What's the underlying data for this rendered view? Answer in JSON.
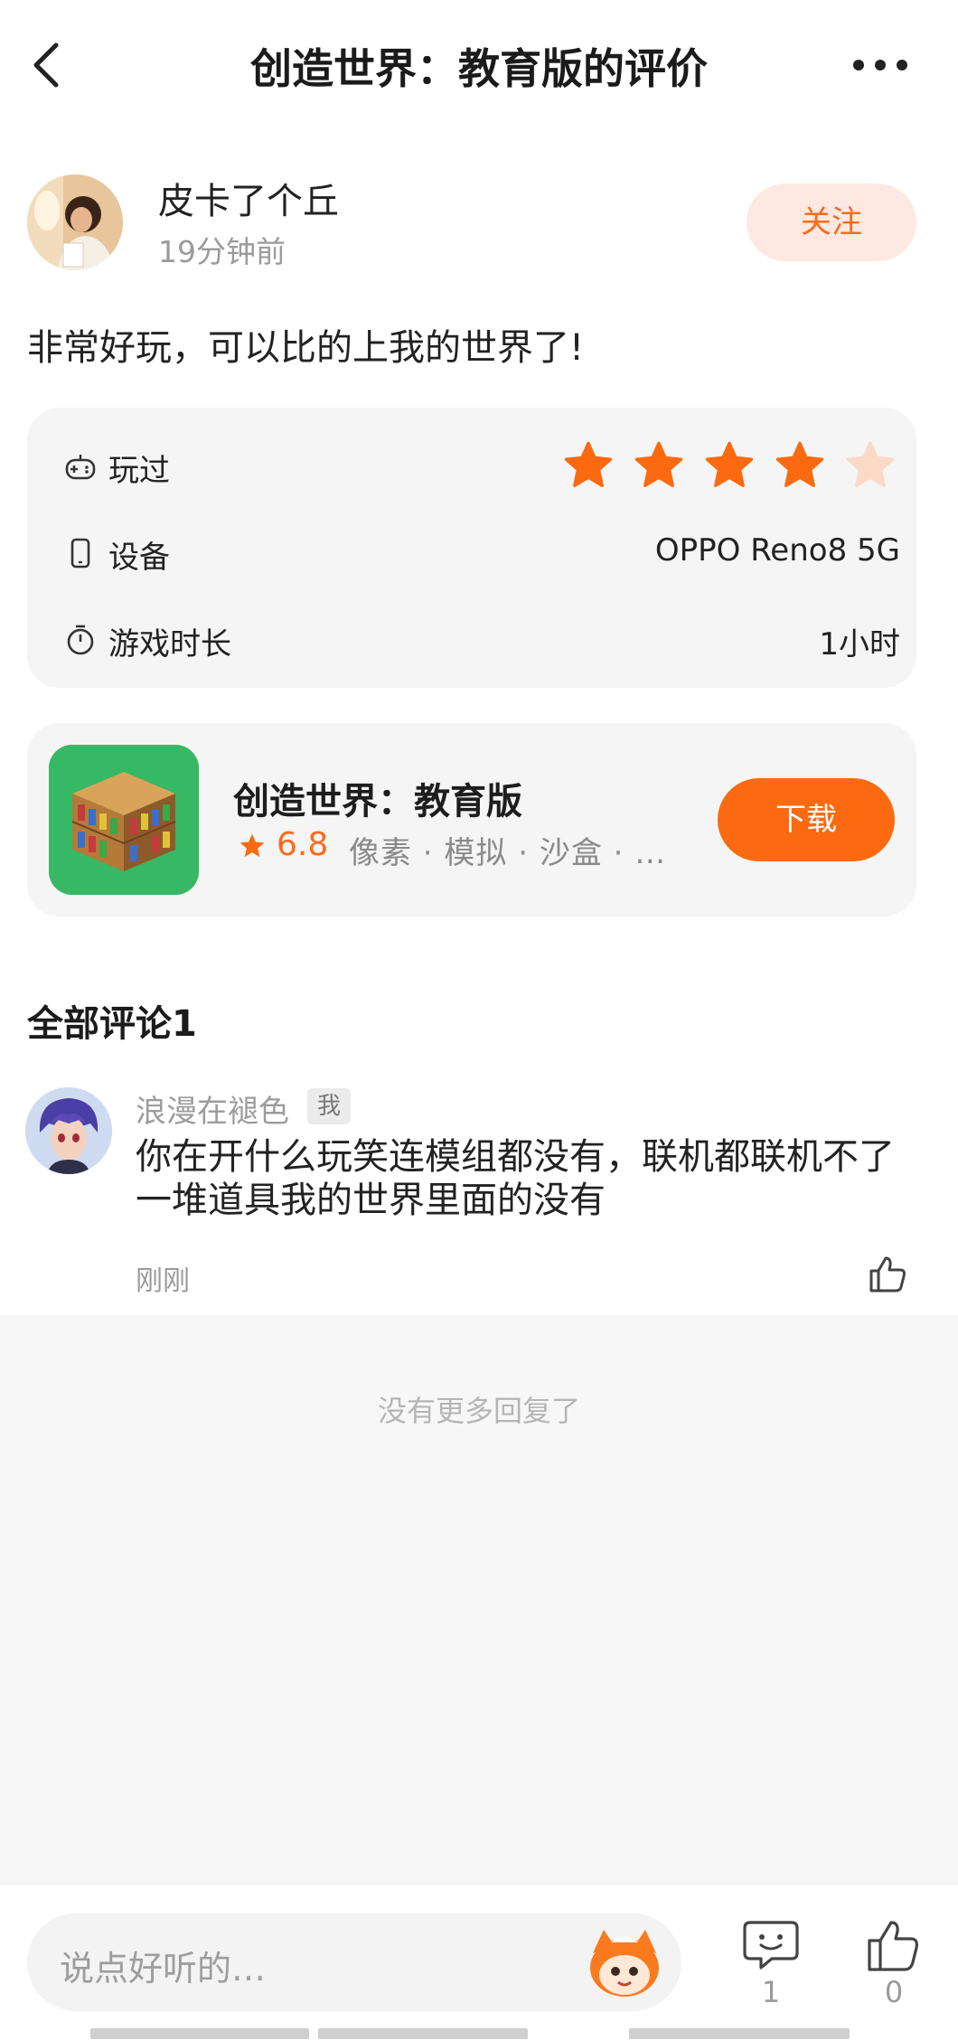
{
  "header": {
    "title": "创造世界：教育版的评价"
  },
  "author": {
    "name": "皮卡了个丘",
    "time": "19分钟前",
    "follow_label": "关注"
  },
  "review": {
    "text": "非常好玩，可以比的上我的世界了!"
  },
  "info": {
    "played_label": "玩过",
    "rating_stars": 4,
    "rating_max": 5,
    "device_label": "设备",
    "device_value": "OPPO Reno8 5G",
    "playtime_label": "游戏时长",
    "playtime_value": "1小时"
  },
  "app": {
    "name": "创造世界：教育版",
    "rating": "6.8",
    "tags": "像素 · 模拟 · 沙盒 · …",
    "download_label": "下载"
  },
  "comments": {
    "heading": "全部评论1",
    "items": [
      {
        "user": "浪漫在褪色",
        "badge": "我",
        "text": "你在开什么玩笑连模组都没有，联机都联机不了一堆道具我的世界里面的没有",
        "time": "刚刚"
      }
    ],
    "no_more": "没有更多回复了"
  },
  "bottom": {
    "input_placeholder": "说点好听的…",
    "comment_count": "1",
    "like_count": "0"
  },
  "colors": {
    "accent": "#fb6a10",
    "star_filled": "#fb6a10",
    "star_empty": "#fbd9c6",
    "app_bg": "#37b864"
  }
}
